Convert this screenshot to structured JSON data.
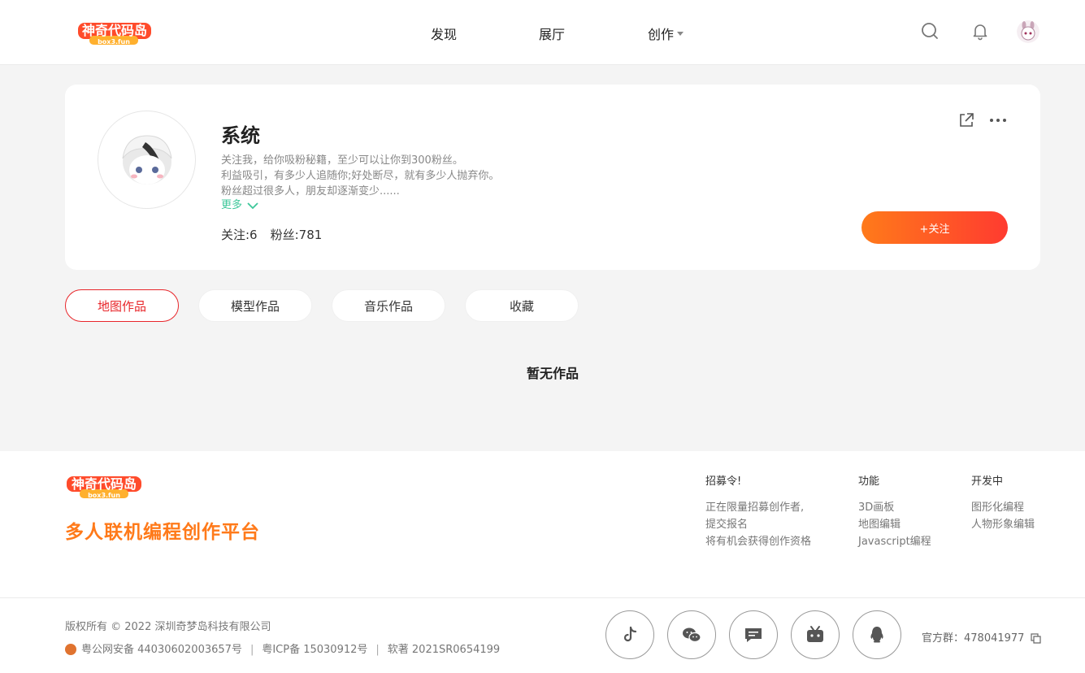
{
  "header": {
    "logo_text": "神奇代码岛",
    "nav": [
      {
        "label": "发现"
      },
      {
        "label": "展厅"
      },
      {
        "label": "创作"
      }
    ]
  },
  "profile": {
    "name": "系统",
    "bio_lines": [
      "关注我，给你吸粉秘籍，至少可以让你到300粉丝。",
      "利益吸引，有多少人追随你;好处断尽，就有多少人抛弃你。",
      "粉丝超过很多人，朋友却逐渐变少......"
    ],
    "more_label": "更多",
    "following": "关注:6",
    "followers": "粉丝:781",
    "follow_button": "+关注"
  },
  "tabs": [
    {
      "label": "地图作品",
      "active": true
    },
    {
      "label": "模型作品",
      "active": false
    },
    {
      "label": "音乐作品",
      "active": false
    },
    {
      "label": "收藏",
      "active": false
    }
  ],
  "empty_text": "暂无作品",
  "footer": {
    "slogan": "多人联机编程创作平台",
    "columns": [
      {
        "title": "招募令!",
        "items": [
          "正在限量招募创作者,",
          "提交报名",
          "将有机会获得创作资格"
        ]
      },
      {
        "title": "功能",
        "items": [
          "3D画板",
          "地图编辑",
          "Javascript编程"
        ]
      },
      {
        "title": "开发中",
        "items": [
          "图形化编程",
          "人物形象编辑"
        ]
      }
    ],
    "copyright": "版权所有 © 2022 深圳奇梦岛科技有限公司",
    "beian": {
      "police": "粤公网安备 44030602003657号",
      "icp": "粤ICP备 15030912号",
      "software": "软著 2021SR0654199"
    },
    "social_icons": [
      "tiktok-icon",
      "wechat-icon",
      "chat-icon",
      "bilibili-icon",
      "qq-icon"
    ],
    "group_label": "官方群：478041977"
  },
  "colors": {
    "accent": "#e8262a",
    "orange": "#ff7a1a",
    "green": "#3ec79a"
  }
}
